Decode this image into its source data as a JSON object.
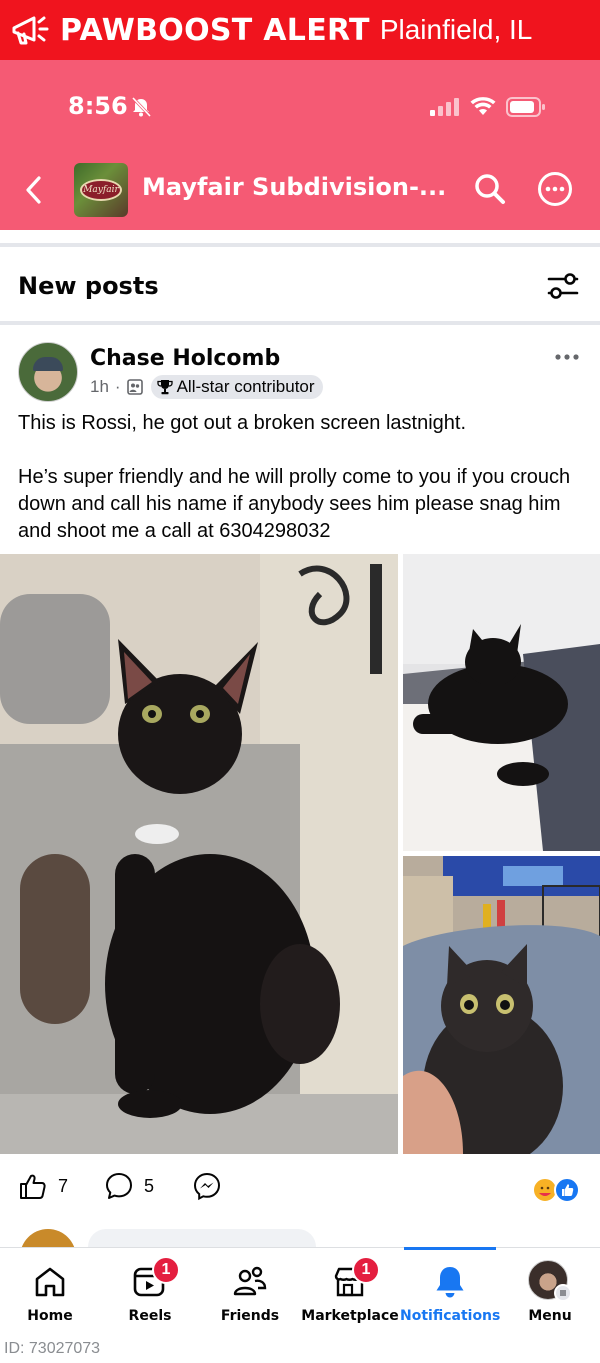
{
  "alert": {
    "brand": "PAWBOOST ALERT",
    "location": "Plainfield, IL"
  },
  "status_bar": {
    "time": "8:56"
  },
  "group": {
    "name": "Mayfair Subdivision-...",
    "thumb_text": "Mayfair"
  },
  "section": {
    "title": "New posts"
  },
  "post": {
    "author": "Chase Holcomb",
    "age": "1h",
    "badge": "All-star contributor",
    "text_1": "This is Rossi, he got out a broken screen lastnight.",
    "text_2": "He’s super friendly and he will prolly come to you if you crouch down and call his name if anybody sees him please snag him and shoot me a call at 6304298032",
    "likes": "7",
    "comments": "5"
  },
  "comment_peek": {
    "name": ""
  },
  "nav": {
    "home": "Home",
    "reels": "Reels",
    "reels_badge": "1",
    "friends": "Friends",
    "marketplace": "Marketplace",
    "marketplace_badge": "1",
    "notifications": "Notifications",
    "menu": "Menu"
  },
  "footer": {
    "id": "ID: 73027073"
  },
  "colors": {
    "alert_red": "#f0141e",
    "header_pink": "#f55a74",
    "fb_blue": "#1877f2",
    "badge_red": "#e41e3f"
  }
}
